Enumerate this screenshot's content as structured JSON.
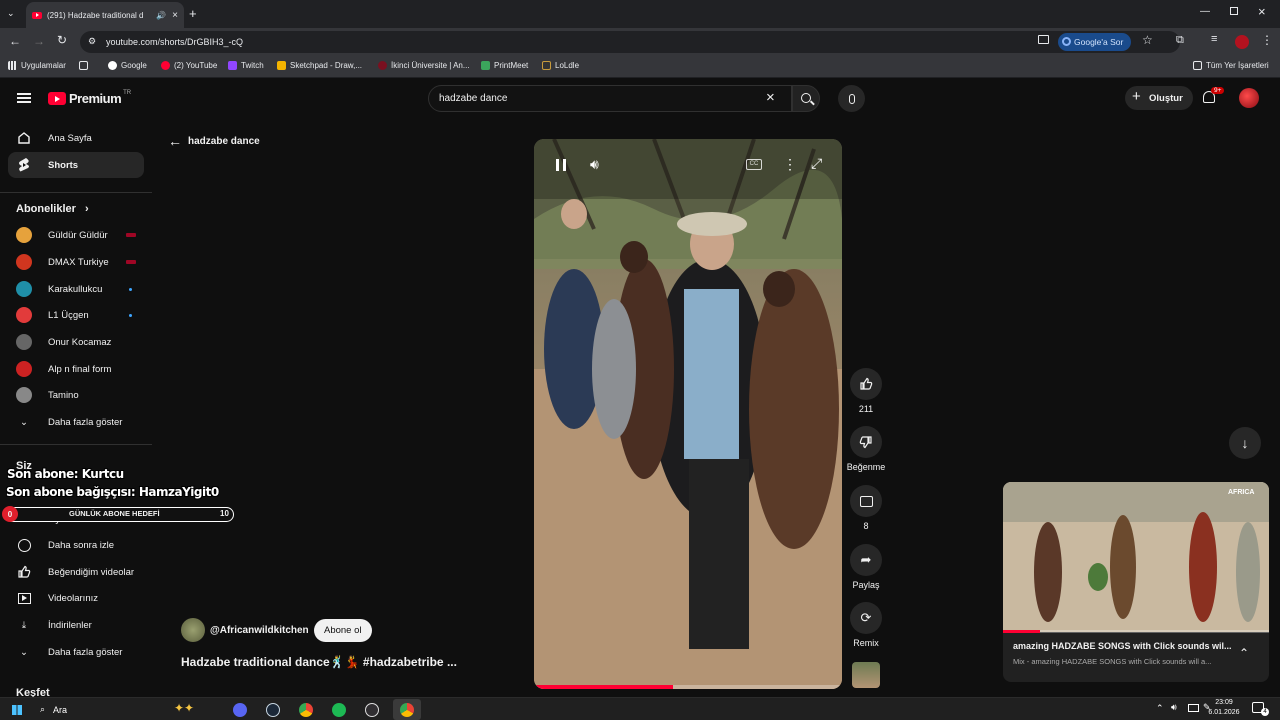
{
  "browser": {
    "tab_title": "(291) Hadzabe traditional d",
    "url": "youtube.com/shorts/DrGBIH3_-cQ",
    "google_ask": "Google'a Sor",
    "bookmarks": [
      "Uygulamalar",
      "Google",
      "(2) YouTube",
      "Twitch",
      "Sketchpad - Draw,...",
      "İkinci Üniversite | An...",
      "PrintMeet",
      "LoLdle"
    ],
    "all_bookmarks": "Tüm Yer İşaretleri"
  },
  "youtube": {
    "logo": "Premium",
    "logo_sup": "TR",
    "search_value": "hadzabe dance",
    "create_label": "Oluştur",
    "notif_count": "9+",
    "back_label": "hadzabe dance"
  },
  "sidebar": {
    "home": "Ana Sayfa",
    "shorts": "Shorts",
    "subs_header": "Abonelikler",
    "subs": [
      {
        "name": "Güldür Güldür",
        "badge": "live",
        "color": "#e6a23c"
      },
      {
        "name": "DMAX Turkiye",
        "badge": "live",
        "color": "#d0361f"
      },
      {
        "name": "Karakullukcu",
        "badge": "dot",
        "color": "#1f8fa8"
      },
      {
        "name": "L1 Üçgen",
        "badge": "dot",
        "color": "#e23b3b"
      },
      {
        "name": "Onur Kocamaz",
        "badge": "",
        "color": "#666666"
      },
      {
        "name": "Alp n final form",
        "badge": "",
        "color": "#cc2222"
      },
      {
        "name": "Tamino",
        "badge": "",
        "color": "#888888"
      }
    ],
    "show_more": "Daha fazla göster",
    "you_header": "Siz",
    "history": "Oynatma listeleri",
    "watch_later": "Daha sonra izle",
    "liked": "Beğendiğim videolar",
    "your_videos": "Videolarınız",
    "downloads": "İndirilenler",
    "show_more2": "Daha fazla göster",
    "explore": "Keşfet"
  },
  "overlay": {
    "last_sub": "Son abone: Kurtcu",
    "last_donor": "Son abone bağışçısı: HamzaYigit0",
    "goal_label": "GÜNLÜK ABONE HEDEFİ",
    "goal_current": "0",
    "goal_target": "10",
    "goal_progress": 0
  },
  "short": {
    "channel": "@Africanwildkitchen",
    "subscribe": "Abone ol",
    "title": "Hadzabe traditional dance🕺💃 #hadzabetribe ...",
    "likes": "211",
    "dislike_label": "Beğenme",
    "comments": "8",
    "share_label": "Paylaş",
    "remix_label": "Remix",
    "progress": 0.45
  },
  "miniplayer": {
    "title": "amazing HADZABE SONGS with Click sounds wil...",
    "subtitle": "Mix - amazing HADZABE SONGS with Click sounds will a...",
    "watermark": "AFRICA",
    "progress": 0.14
  },
  "taskbar": {
    "search": "Ara",
    "time": "23:09",
    "date": "6.01.2026",
    "notif": "4"
  }
}
